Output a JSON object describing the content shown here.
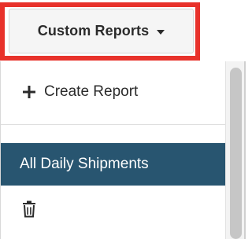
{
  "trigger": {
    "label": "Custom Reports"
  },
  "menu": {
    "create_label": "Create Report",
    "items": [
      {
        "label": "All Daily Shipments",
        "active": true
      }
    ]
  },
  "icons": {
    "caret": "chevron-down-icon",
    "plus": "plus-icon",
    "trash": "trash-icon"
  },
  "colors": {
    "highlight": "#e8322b",
    "active_background": "#285570",
    "active_text": "#ffffff"
  }
}
